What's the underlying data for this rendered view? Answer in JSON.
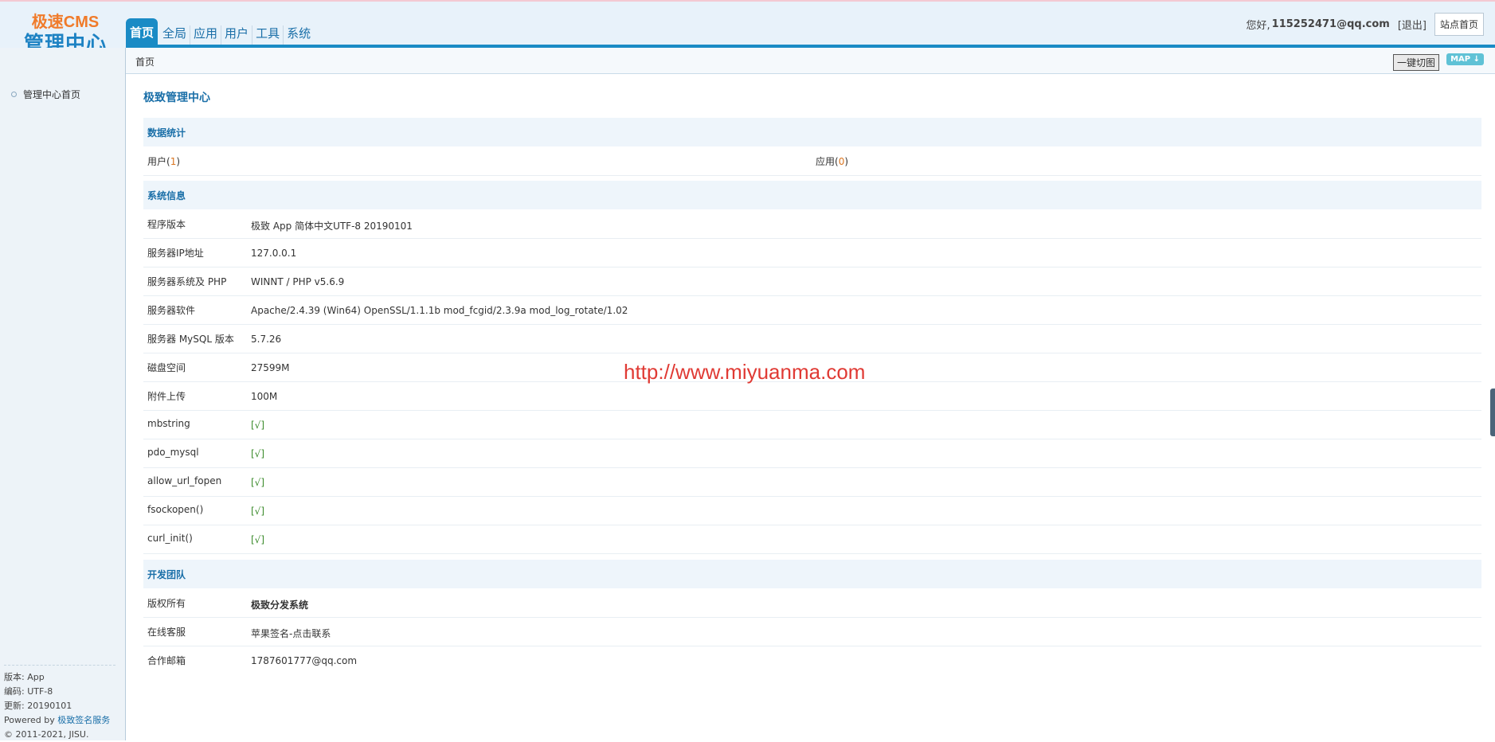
{
  "logo": {
    "line1": "极速CMS",
    "line2": "管理中心"
  },
  "nav": {
    "tabs": [
      "首页",
      "全局",
      "应用",
      "用户",
      "工具",
      "系统"
    ]
  },
  "user": {
    "greeting": "您好,",
    "email": "115252471@qq.com",
    "logout": "[退出]",
    "site_home": "站点首页"
  },
  "breadcrumb": {
    "current": "首页",
    "onekey": "一键切图",
    "map": "MAP ↓"
  },
  "sidebar": {
    "items": [
      "管理中心首页"
    ],
    "footer": {
      "version": "版本: App",
      "encoding": "编码: UTF-8",
      "updated": "更新: 20190101",
      "powered_prefix": "Powered by",
      "powered_link": "极致签名服务",
      "copyright": "© 2011-2021, JISU."
    }
  },
  "main": {
    "title": "极致管理中心",
    "stats": {
      "title": "数据统计",
      "users_label": "用户",
      "users_count": "1",
      "apps_label": "应用",
      "apps_count": "0"
    },
    "sysinfo": {
      "title": "系统信息",
      "rows": [
        {
          "k": "程序版本",
          "v": "极致 App 简体中文UTF-8 20190101"
        },
        {
          "k": "服务器IP地址",
          "v": "127.0.0.1"
        },
        {
          "k": "服务器系统及 PHP",
          "v": "WINNT / PHP v5.6.9"
        },
        {
          "k": "服务器软件",
          "v": "Apache/2.4.39 (Win64) OpenSSL/1.1.1b mod_fcgid/2.3.9a mod_log_rotate/1.02"
        },
        {
          "k": "服务器 MySQL 版本",
          "v": "5.7.26"
        },
        {
          "k": "磁盘空间",
          "v": "27599M"
        },
        {
          "k": "附件上传",
          "v": "100M"
        },
        {
          "k": "mbstring",
          "v": "[√]"
        },
        {
          "k": "pdo_mysql",
          "v": "[√]"
        },
        {
          "k": "allow_url_fopen",
          "v": "[√]"
        },
        {
          "k": "fsockopen()",
          "v": "[√]"
        },
        {
          "k": "curl_init()",
          "v": "[√]"
        }
      ]
    },
    "team": {
      "title": "开发团队",
      "rows": [
        {
          "k": "版权所有",
          "v": "极致分发系统"
        },
        {
          "k": "在线客服",
          "v": "苹果签名-点击联系"
        },
        {
          "k": "合作邮箱",
          "v": "1787601777@qq.com"
        }
      ]
    }
  },
  "watermark": "http://www.miyuanma.com",
  "colors": {
    "accent": "#1a8bc5",
    "logo_orange": "#f07b2a",
    "ok_green": "#3a8a2a",
    "watermark": "#e03a34"
  }
}
